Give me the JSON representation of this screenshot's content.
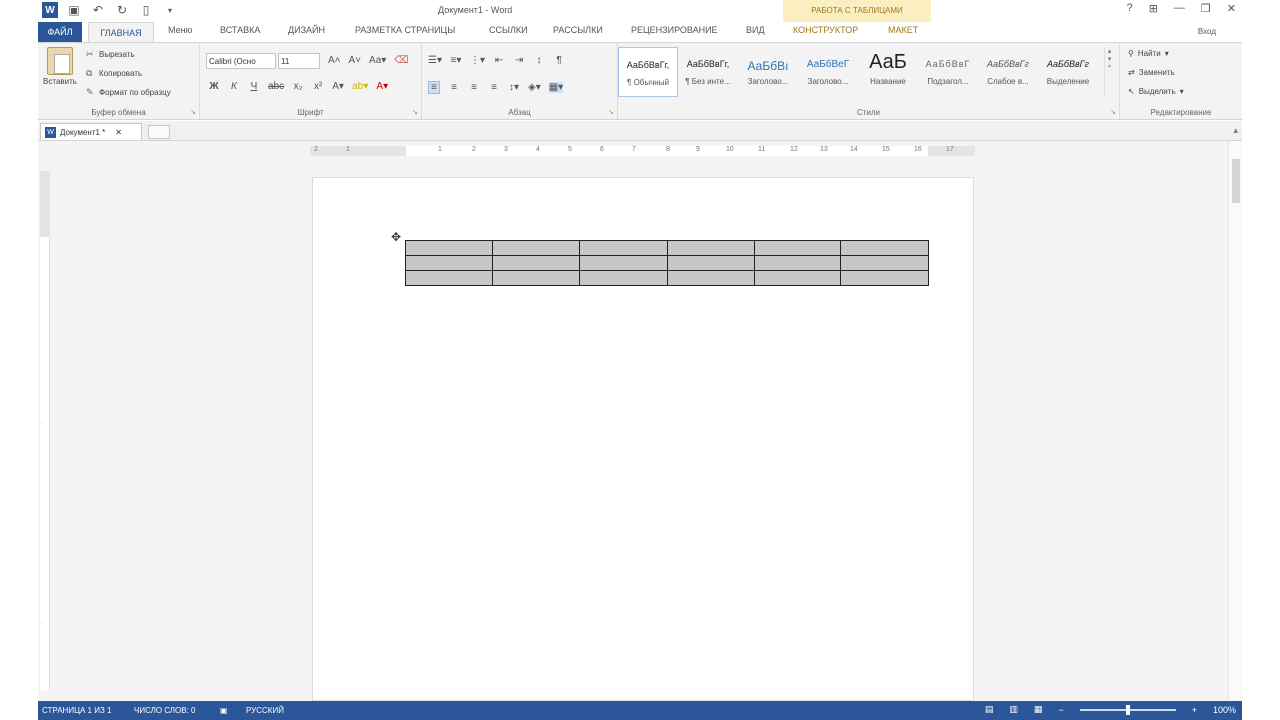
{
  "window": {
    "title": "Документ1 - Word",
    "context_group": "РАБОТА С ТАБЛИЦАМИ",
    "sign_in": "Вход",
    "buttons": [
      "?",
      "⊞",
      "—",
      "❐",
      "✕"
    ]
  },
  "tabs": {
    "file": "ФАЙЛ",
    "home": "ГЛАВНАЯ",
    "items": [
      "Меню",
      "ВСТАВКА",
      "ДИЗАЙН",
      "РАЗМЕТКА СТРАНИЦЫ",
      "ССЫЛКИ",
      "РАССЫЛКИ",
      "РЕЦЕНЗИРОВАНИЕ",
      "ВИД"
    ],
    "context_items": [
      "КОНСТРУКТОР",
      "МАКЕТ"
    ]
  },
  "ribbon": {
    "clipboard": {
      "label": "Буфер обмена",
      "paste": "Вставить",
      "cut": "Вырезать",
      "copy": "Копировать",
      "format_painter": "Формат по образцу"
    },
    "font": {
      "label": "Шрифт",
      "font_name": "Calibri (Осно",
      "font_size": "11"
    },
    "paragraph": {
      "label": "Абзац"
    },
    "styles": {
      "label": "Стили",
      "items": [
        {
          "sample": "АаБбВвГг,",
          "name": "¶ Обычный"
        },
        {
          "sample": "АаБбВвГг,",
          "name": "¶ Без инте..."
        },
        {
          "sample": "АаБбВı",
          "name": "Заголово..."
        },
        {
          "sample": "АаБбВеГ",
          "name": "Заголово..."
        },
        {
          "sample": "АаБ",
          "name": "Название"
        },
        {
          "sample": "АаБбВвГ",
          "name": "Подзагол..."
        },
        {
          "sample": "АаБбВвГг",
          "name": "Слабое в..."
        },
        {
          "sample": "АаБбВвГг",
          "name": "Выделение"
        }
      ]
    },
    "editing": {
      "label": "Редактирование",
      "find": "Найти",
      "replace": "Заменить",
      "select": "Выделить"
    }
  },
  "document_tab": {
    "name": "Документ1 *",
    "close": "✕"
  },
  "ruler": {
    "numbers": [
      "2",
      "1",
      "1",
      "2",
      "3",
      "4",
      "5",
      "6",
      "7",
      "8",
      "9",
      "10",
      "11",
      "12",
      "13",
      "14",
      "15",
      "16",
      "17"
    ]
  },
  "table": {
    "rows": 3,
    "cols": 6
  },
  "statusbar": {
    "page": "СТРАНИЦА 1 ИЗ 1",
    "words": "ЧИСЛО СЛОВ: 0",
    "language": "РУССКИЙ",
    "zoom": "100%"
  },
  "colors": {
    "accent": "#2b579a",
    "context": "#fbeec1",
    "table_fill": "#c7c7c7"
  }
}
